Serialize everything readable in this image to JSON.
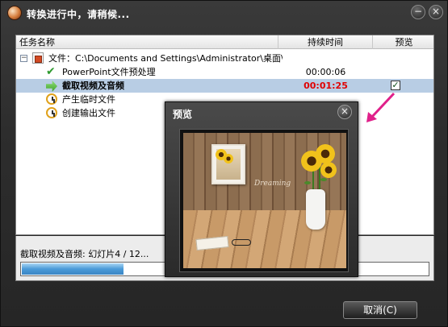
{
  "window": {
    "title": "转换进行中，请稍候...",
    "minimize_glyph": "−",
    "close_glyph": "×"
  },
  "table": {
    "columns": [
      "任务名称",
      "持续时间",
      "预览"
    ],
    "root": {
      "expander": "−",
      "label": "文件：C:\\Documents and Settings\\Administrator\\桌面\\..."
    },
    "tasks": [
      {
        "label": "PowerPoint文件预处理",
        "duration": "00:00:06",
        "icon": "check-icon",
        "state": "done"
      },
      {
        "label": "截取视频及音频",
        "duration": "00:01:25",
        "icon": "arrow-icon",
        "state": "running",
        "preview_checked": true
      },
      {
        "label": "产生临时文件",
        "duration": "",
        "icon": "clock-icon",
        "state": "pending"
      },
      {
        "label": "创建输出文件",
        "duration": "",
        "icon": "clock-icon",
        "state": "pending"
      }
    ]
  },
  "status": {
    "text": "截取视频及音频: 幻灯片4 / 12...",
    "progress": 0.25
  },
  "buttons": {
    "cancel": "取消(C)"
  },
  "preview_window": {
    "title": "预览",
    "close_glyph": "×",
    "slide_script": "Dreaming"
  },
  "colors": {
    "accent_red": "#e00000",
    "selection": "#b8cde4",
    "annotation_arrow": "#e0208a"
  }
}
